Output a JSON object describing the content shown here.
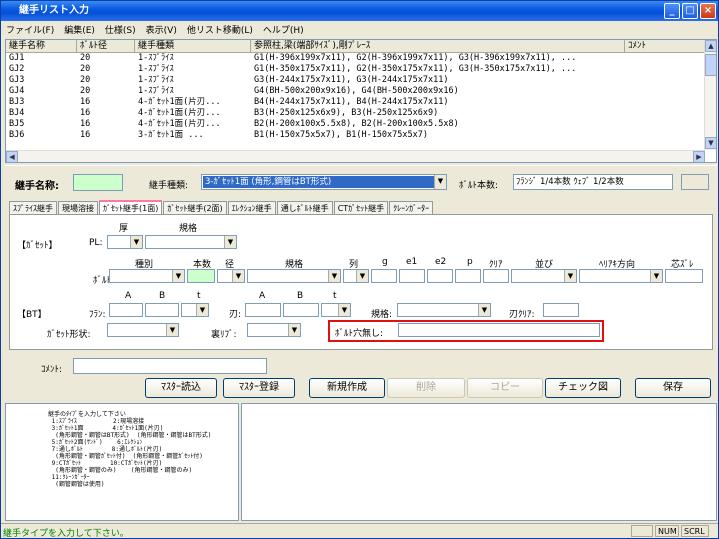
{
  "window": {
    "title": "継手リスト入力"
  },
  "menu": [
    "ファイル(F)",
    "編集(E)",
    "仕様(S)",
    "表示(V)",
    "他リスト移動(L)",
    "ヘルプ(H)"
  ],
  "list": {
    "headers": [
      "継手名称",
      "ﾎﾞﾙﾄ径",
      "継手種類",
      "参照柱,梁(端部ｻｲｽﾞ),剛ﾌﾟﾚｰｽ",
      "ｺﾒﾝﾄ"
    ],
    "rows": [
      [
        "GJ1",
        "20",
        "1-ｽﾌﾟﾗｲｽ",
        "G1(H-396x199x7x11), G2(H-396x199x7x11), G3(H-396x199x7x11), ...",
        ""
      ],
      [
        "GJ2",
        "20",
        "1-ｽﾌﾟﾗｲｽ",
        "G1(H-350x175x7x11), G2(H-350x175x7x11), G3(H-350x175x7x11), ...",
        ""
      ],
      [
        "GJ3",
        "20",
        "1-ｽﾌﾟﾗｲｽ",
        "G3(H-244x175x7x11), G3(H-244x175x7x11)",
        ""
      ],
      [
        "GJ4",
        "20",
        "1-ｽﾌﾟﾗｲｽ",
        "G4(BH-500x200x9x16), G4(BH-500x200x9x16)",
        ""
      ],
      [
        "BJ3",
        "16",
        "4-ｶﾞｾｯﾄ1面(片刃...",
        "B4(H-244x175x7x11), B4(H-244x175x7x11)",
        ""
      ],
      [
        "BJ4",
        "16",
        "4-ｶﾞｾｯﾄ1面(片刃...",
        "B3(H-250x125x6x9), B3(H-250x125x6x9)",
        ""
      ],
      [
        "BJ5",
        "16",
        "4-ｶﾞｾｯﾄ1面(片刃...",
        "B2(H-200x100x5.5x8), B2(H-200x100x5.5x8)",
        ""
      ],
      [
        "BJ6",
        "16",
        "3-ｶﾞｾｯﾄ1面  ...",
        "B1(H-150x75x5x7), B1(H-150x75x5x7)",
        ""
      ]
    ]
  },
  "form": {
    "joint_name_label": "継手名称:",
    "joint_type_label": "継手種類:",
    "joint_type_value": "3-ｶﾞｾｯﾄ1面         (角形,鋼管はBT形式)",
    "bolt_count_label": "ﾎﾞﾙﾄ本数:",
    "bolt_count_value": "ﾌﾗﾝｼﾞ 1/4本数 ｳｪﾌﾞ  1/2本数"
  },
  "tabs": [
    "ｽﾌﾟﾗｲｽ継手",
    "現場溶接",
    "ｶﾞｾｯﾄ継手(1面)",
    "ｶﾞｾｯﾄ継手(2面)",
    "ｴﾚｸｼｮﾝ継手",
    "通しﾎﾞﾙﾄ継手",
    "CTｶﾞｾｯﾄ継手",
    "ｸﾚｰﾝｶﾞｰﾀｰ"
  ],
  "tab_content": {
    "thick": "厚",
    "spec": "規格",
    "gusset": "【ｶﾞｾｯﾄ】",
    "pl": "PL:",
    "kind": "種別",
    "count": "本数",
    "dia": "径",
    "spec2": "規格",
    "col": "列",
    "g": "g",
    "e1": "e1",
    "e2": "e2",
    "p": "p",
    "clear": "ｸﾘｱ",
    "arrange": "並び",
    "hel": "ﾍﾘｱｷ方向",
    "core": "芯ｽﾞﾚ",
    "bolt": "ﾎﾞﾙﾄ:",
    "A": "A",
    "B": "B",
    "t": "t",
    "A2": "A",
    "B2": "B",
    "t2": "t",
    "bt": "【BT】",
    "flange": "ﾌﾗﾝ:",
    "blade": "刃:",
    "spec3": "規格:",
    "bladeclear": "刃ｸﾘｱ:",
    "shape": "ｶﾞｾｯﾄ形状:",
    "rib": "裏ﾘﾌﾞ:",
    "nohole": "ﾎﾞﾙﾄ穴無し:"
  },
  "comment_label": "ｺﾒﾝﾄ:",
  "buttons": {
    "master_load": "ﾏｽﾀｰ読込",
    "master_register": "ﾏｽﾀｰ登録",
    "new": "新規作成",
    "delete": "削除",
    "copy": "コピー",
    "check": "チェック図",
    "save": "保存"
  },
  "help_text": "継手のﾀｲﾌﾟを入力して下さい\n 1:ｽﾌﾟﾗｲｽ          2:現場溶接\n 3:ｶﾞｾｯﾄ1面        4:ｶﾞｾｯﾄ1面(片刃)\n  (角形鋼管・鋼管はBT形式)  (角形鋼管・鋼管はBT形式)\n 5:ｶﾞｾｯﾄ2面(ｻﾝﾄﾞ)    6:ｴﾚｸｼｮﾝ\n 7:通しﾎﾞﾙﾄ        8:通しﾎﾞﾙﾄ(片刃)\n  (角形鋼管・鋼管ｶﾞｾｯﾄ付)  (角形鋼管・鋼管ｶﾞｾｯﾄ付)\n 9:CTｶﾞｾｯﾄ        10:CTｶﾞｾｯﾄ(片刃)\n  (角形鋼管・鋼管のみ)    (角形鋼管・鋼管のみ)\n 11:ｸﾚｰﾝｶﾞｰﾀｰ\n  (鋼管鋼管は使用)",
  "status": {
    "message": "継手タイプを入力して下さい。",
    "num": "NUM",
    "scrl": "SCRL"
  }
}
